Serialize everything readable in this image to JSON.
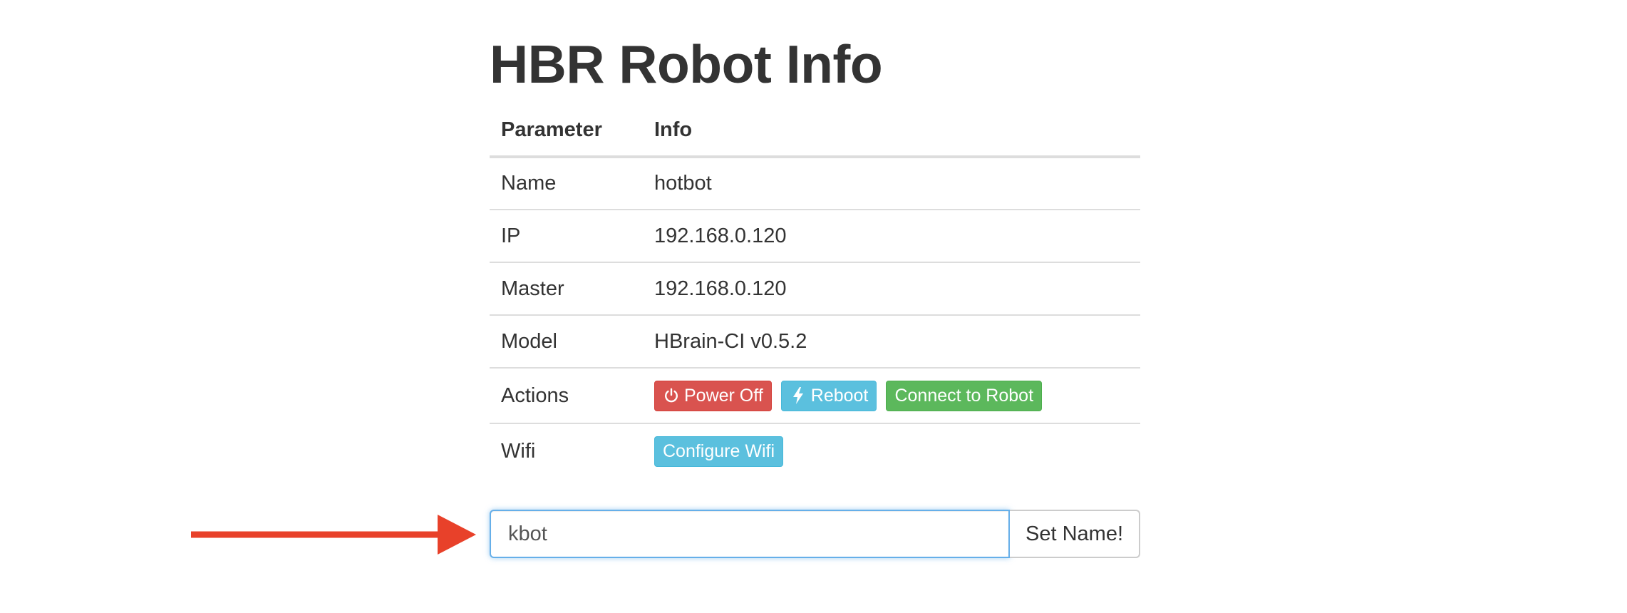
{
  "page": {
    "title": "HBR Robot Info"
  },
  "table": {
    "headers": [
      "Parameter",
      "Info"
    ],
    "rows": [
      {
        "param": "Name",
        "value": "hotbot"
      },
      {
        "param": "IP",
        "value": "192.168.0.120"
      },
      {
        "param": "Master",
        "value": "192.168.0.120"
      },
      {
        "param": "Model",
        "value": "HBrain-CI v0.5.2"
      }
    ],
    "actions_label": "Actions",
    "wifi_label": "Wifi"
  },
  "actions": {
    "power_off": "Power Off",
    "reboot": "Reboot",
    "connect": "Connect to Robot"
  },
  "wifi": {
    "configure": "Configure Wifi"
  },
  "name_form": {
    "input_value": "kbot",
    "button_label": "Set Name!"
  },
  "icons": {
    "power": "power-icon",
    "reboot": "bolt-icon",
    "annotation": "arrow-right-icon"
  },
  "colors": {
    "danger": "#d9534f",
    "info": "#5bc0de",
    "success": "#5cb85c",
    "arrow": "#e8412a",
    "focus": "#66afe9"
  }
}
